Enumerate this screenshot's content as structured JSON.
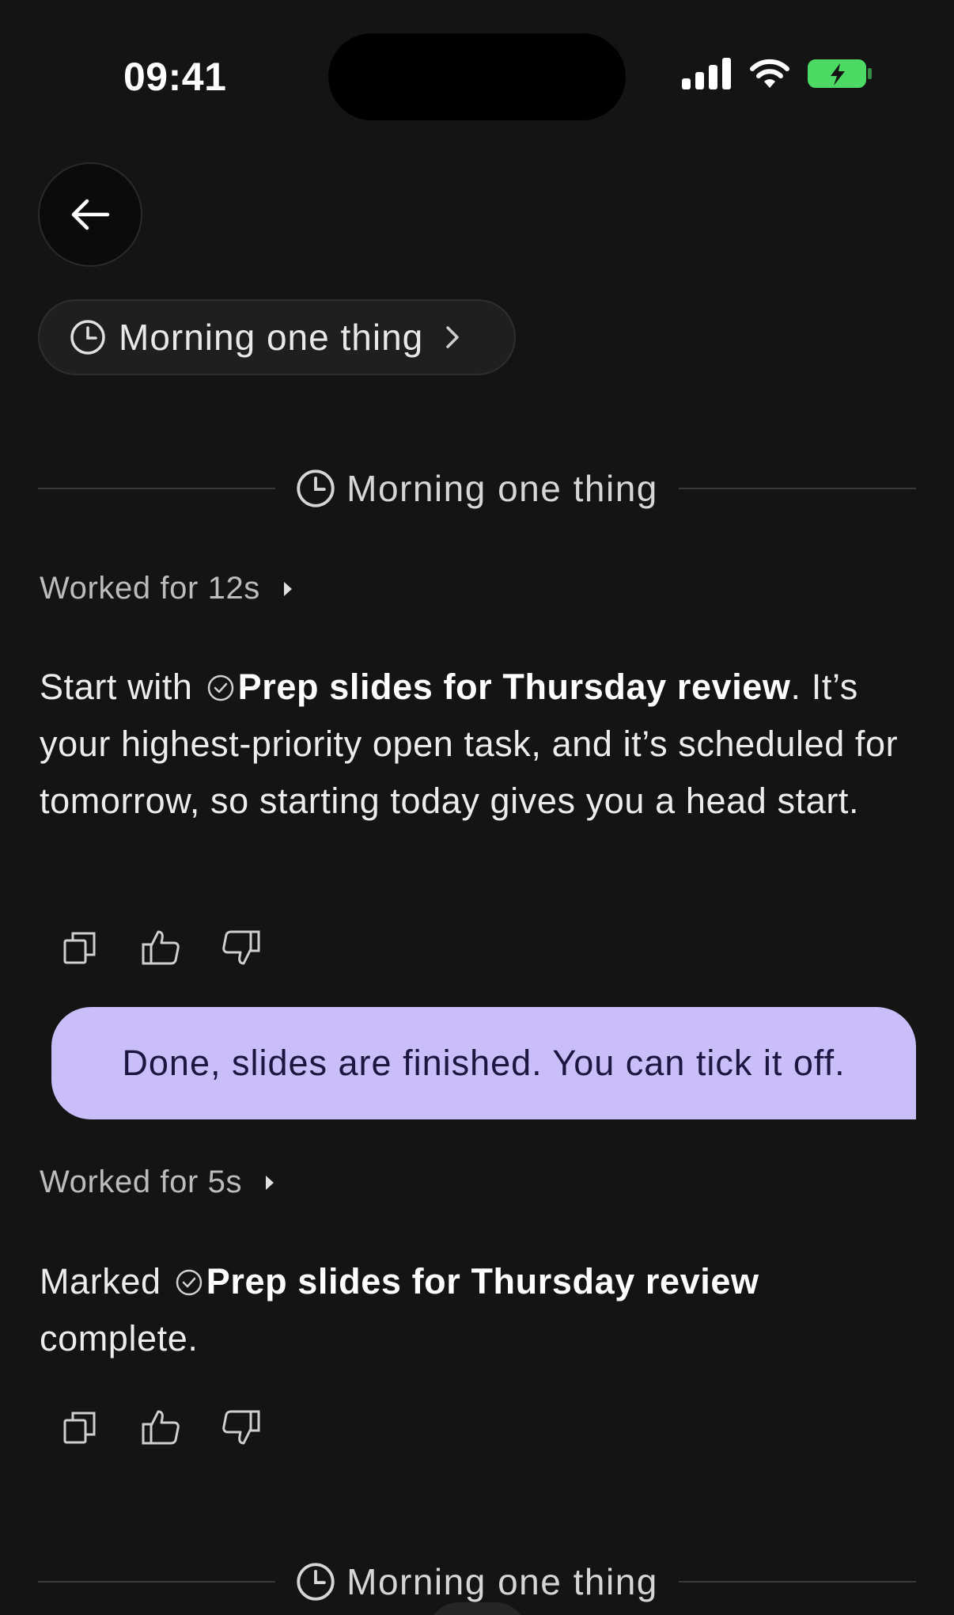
{
  "status_bar": {
    "time": "09:41",
    "icons": [
      "signal-icon",
      "wifi-icon",
      "battery-charging-icon"
    ],
    "battery_color": "#4cd964"
  },
  "header": {
    "back_icon": "arrow-left-icon",
    "chip_label": "Morning one thing",
    "chip_icon": "clock-icon",
    "chip_chevron": "chevron-right-icon"
  },
  "thread": [
    {
      "divider_label": "Morning one thing"
    },
    {
      "worked_label": "Worked for 12s",
      "message": {
        "prefix": "Start with",
        "task": "Prep slides for Thursday review",
        "suffix": ". It’s your highest-priority open task, and it’s scheduled for tomorrow, so starting today gives you a head start."
      }
    },
    {
      "user_message": "Done, slides are finished. You can tick it off."
    },
    {
      "worked_label": "Worked for 5s",
      "message": {
        "prefix": "Marked",
        "task": "Prep slides for Thursday review",
        "suffix": " complete."
      }
    },
    {
      "divider_label": "Morning one thing"
    }
  ],
  "colors": {
    "background": "#141414",
    "user_bubble": "#c9bdfa",
    "user_bubble_text": "#1c1640"
  }
}
